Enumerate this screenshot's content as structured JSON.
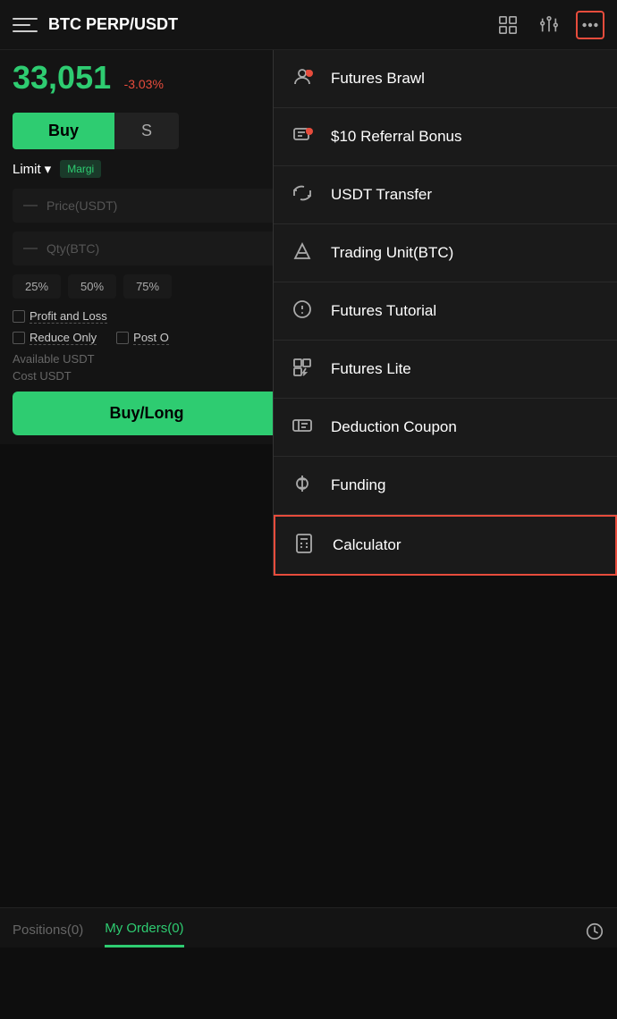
{
  "header": {
    "title": "BTC PERP/USDT",
    "menu_icon": "menu-icon",
    "chart_icon": "chart-icon",
    "indicators_icon": "indicators-icon",
    "more_icon": "more-icon"
  },
  "price": {
    "value": "33,051",
    "change": "-3.03%"
  },
  "trade": {
    "buy_label": "Buy",
    "sell_label": "S",
    "limit_label": "Limit",
    "margin_label": "Margi",
    "price_placeholder": "Price(USDT)",
    "qty_placeholder": "Qty(BTC)",
    "percent_buttons": [
      "25%",
      "50%",
      "75%"
    ],
    "profit_loss_label": "Profit and Loss",
    "reduce_only_label": "Reduce Only",
    "post_only_label": "Post O",
    "available_label": "Available USDT",
    "cost_label": "Cost USDT",
    "buy_long_label": "Buy/Long"
  },
  "bottom_tabs": {
    "positions_label": "Positions(0)",
    "orders_label": "My Orders(0)"
  },
  "dropdown": {
    "items": [
      {
        "id": "futures-brawl",
        "label": "Futures Brawl",
        "icon": "pk-icon",
        "has_dot": true,
        "highlighted": false
      },
      {
        "id": "referral-bonus",
        "label": "$10 Referral Bonus",
        "icon": "referral-icon",
        "has_dot": true,
        "highlighted": false
      },
      {
        "id": "usdt-transfer",
        "label": "USDT Transfer",
        "icon": "transfer-icon",
        "has_dot": false,
        "highlighted": false
      },
      {
        "id": "trading-unit",
        "label": "Trading Unit(BTC)",
        "icon": "trading-unit-icon",
        "has_dot": false,
        "highlighted": false
      },
      {
        "id": "futures-tutorial",
        "label": "Futures Tutorial",
        "icon": "tutorial-icon",
        "has_dot": false,
        "highlighted": false
      },
      {
        "id": "futures-lite",
        "label": "Futures Lite",
        "icon": "futures-lite-icon",
        "has_dot": false,
        "highlighted": false
      },
      {
        "id": "deduction-coupon",
        "label": "Deduction Coupon",
        "icon": "coupon-icon",
        "has_dot": false,
        "highlighted": false
      },
      {
        "id": "funding",
        "label": "Funding",
        "icon": "funding-icon",
        "has_dot": false,
        "highlighted": false
      },
      {
        "id": "calculator",
        "label": "Calculator",
        "icon": "calculator-icon",
        "has_dot": false,
        "highlighted": true
      }
    ]
  }
}
